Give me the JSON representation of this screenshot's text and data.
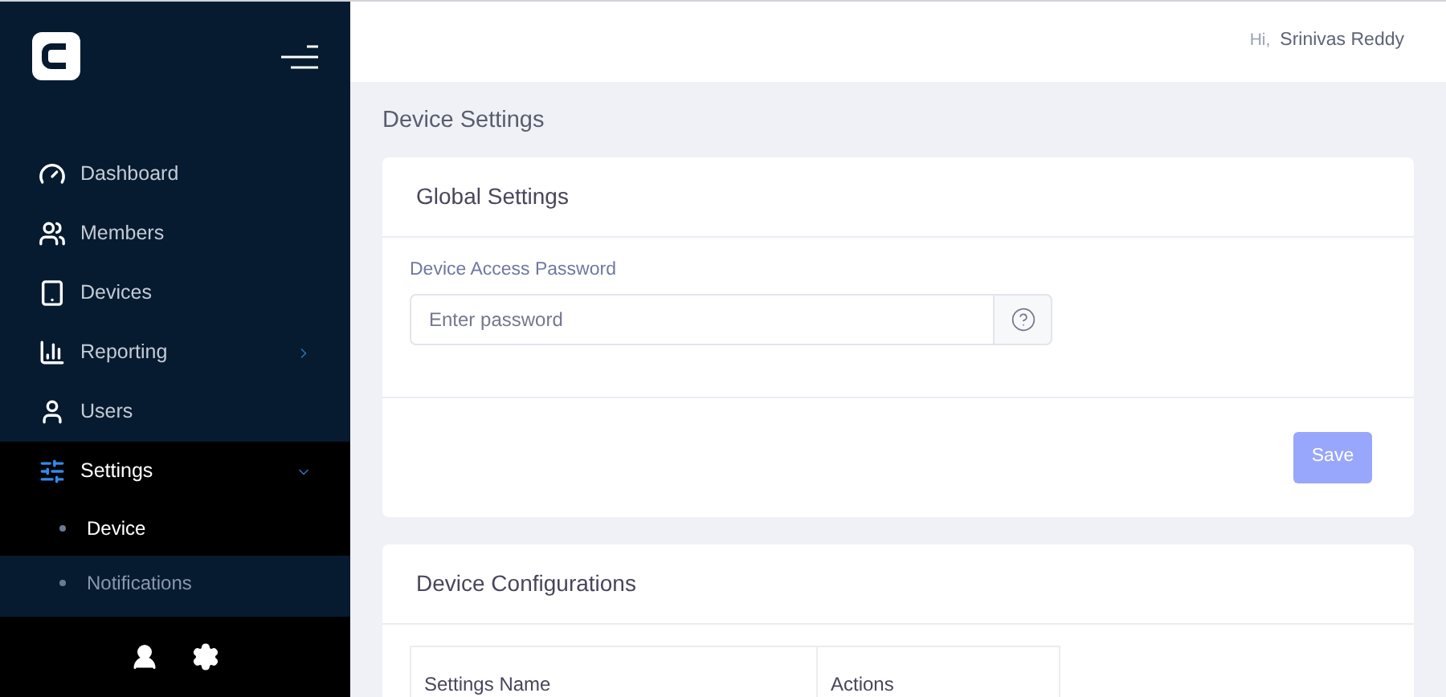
{
  "header": {
    "greeting": "Hi,",
    "user_name": "Srinivas Reddy"
  },
  "sidebar": {
    "items": [
      {
        "label": "Dashboard",
        "selected": false
      },
      {
        "label": "Members",
        "selected": false
      },
      {
        "label": "Devices",
        "selected": false
      },
      {
        "label": "Reporting",
        "selected": false,
        "expanded": false
      },
      {
        "label": "Users",
        "selected": false
      },
      {
        "label": "Settings",
        "selected": true,
        "expanded": true,
        "children": [
          {
            "label": "Device",
            "selected": true
          },
          {
            "label": "Notifications",
            "selected": false
          }
        ]
      }
    ]
  },
  "page_title": "Device Settings",
  "global_settings": {
    "title": "Global Settings",
    "field_label": "Device Access Password",
    "placeholder": "Enter password",
    "save_button": {
      "label": "Save",
      "disabled": true
    }
  },
  "device_configurations": {
    "title": "Device Configurations",
    "table": {
      "columns": [
        "Settings Name",
        "Actions"
      ]
    }
  }
}
